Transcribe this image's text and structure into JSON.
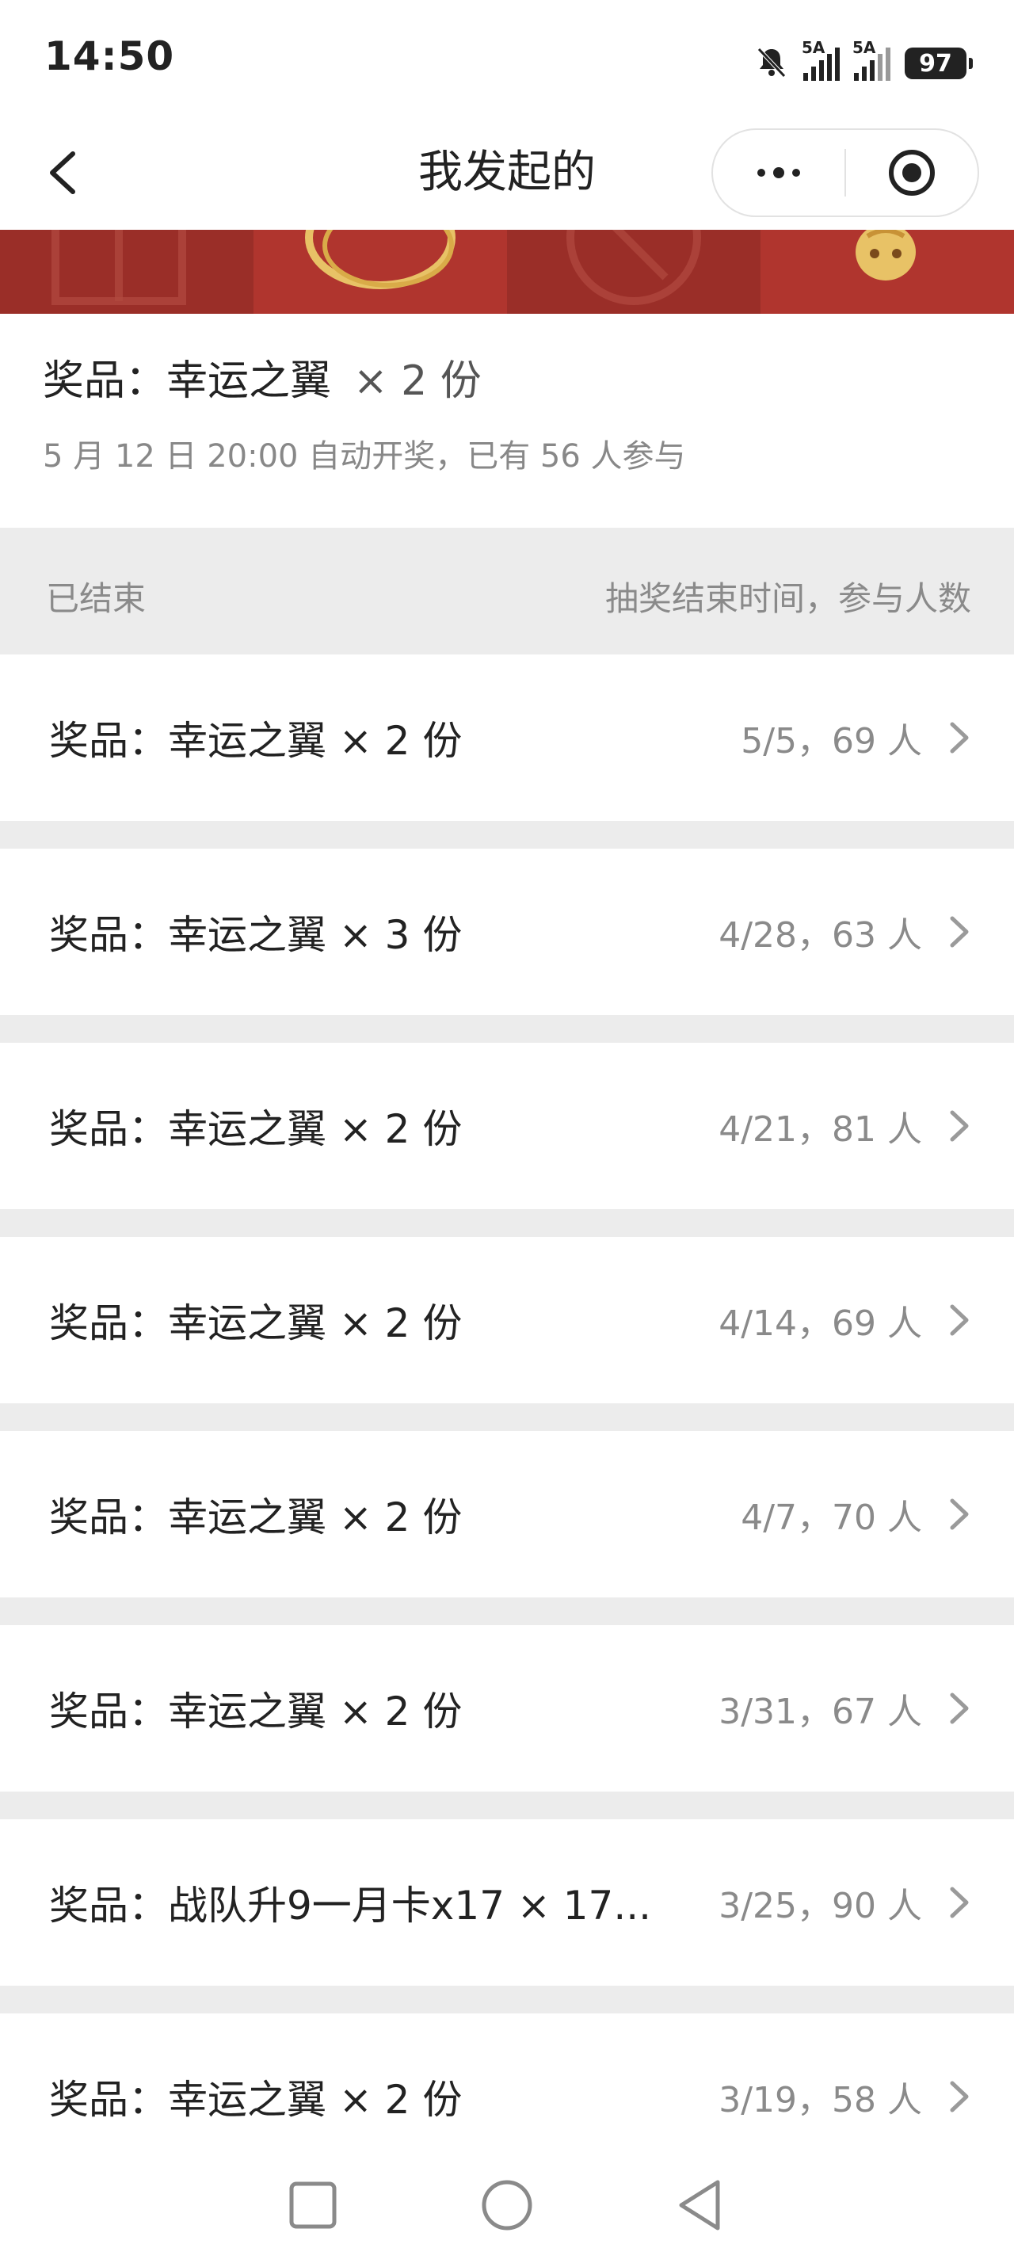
{
  "status": {
    "time": "14:50",
    "signal1": "5A",
    "signal2": "5A",
    "battery": "97"
  },
  "nav": {
    "title": "我发起的"
  },
  "current": {
    "prize_label": "奖品：幸运之翼",
    "quantity": "× 2 份",
    "subtitle": "5 月 12 日 20:00 自动开奖，已有 56 人参与"
  },
  "section": {
    "left": "已结束",
    "right": "抽奖结束时间，参与人数"
  },
  "rows": [
    {
      "prize": "奖品：幸运之翼 × 2 份",
      "meta": "5/5，69 人"
    },
    {
      "prize": "奖品：幸运之翼 × 3 份",
      "meta": "4/28，63 人"
    },
    {
      "prize": "奖品：幸运之翼 × 2 份",
      "meta": "4/21，81 人"
    },
    {
      "prize": "奖品：幸运之翼 × 2 份",
      "meta": "4/14，69 人"
    },
    {
      "prize": "奖品：幸运之翼 × 2 份",
      "meta": "4/7，70 人"
    },
    {
      "prize": "奖品：幸运之翼 × 2 份",
      "meta": "3/31，67 人"
    },
    {
      "prize": "奖品：战队升9一月卡x17 × 17...",
      "meta": "3/25，90 人"
    },
    {
      "prize": "奖品：幸运之翼 × 2 份",
      "meta": "3/19，58 人"
    }
  ],
  "colors": {
    "banner_red": "#9a2e28",
    "banner_red_light": "#b0352e",
    "gold": "#e8c266",
    "separator": "#ececec"
  }
}
